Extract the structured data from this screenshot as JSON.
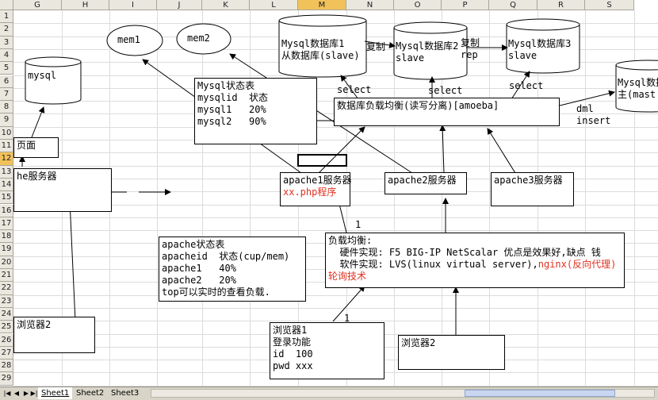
{
  "columns": [
    "G",
    "H",
    "I",
    "J",
    "K",
    "L",
    "M",
    "N",
    "O",
    "P",
    "Q",
    "R",
    "S"
  ],
  "selected_column": "M",
  "rows": [
    "1",
    "2",
    "3",
    "4",
    "5",
    "6",
    "7",
    "8",
    "9",
    "10",
    "11",
    "12",
    "13",
    "14",
    "15",
    "16",
    "17",
    "18",
    "19",
    "20",
    "21",
    "22",
    "23",
    "24",
    "25",
    "26",
    "27",
    "28",
    "29"
  ],
  "selected_row": "12",
  "shapes": {
    "mysql": "mysql",
    "mem1": "mem1",
    "mem2": "mem2",
    "db1": "Mysql数据库1\n从数据库(slave)",
    "copy1": "复制",
    "db2": "Mysql数据库2\nslave",
    "copy2": "复制\nrep",
    "db3": "Mysql数据库3\nslave",
    "master": "Mysql数据\n主(mast",
    "select1": "select",
    "select2": "select",
    "select3": "select",
    "dml": "dml\ninsert",
    "mysql_status": "Mysql状态表\nmysqlid  状态\nmysql1   20%\nmysql2   90%",
    "db_lb": "数据库负载均衡(读写分离)[amoeba]",
    "page_box": "页面",
    "server_box": "he服务器",
    "apache1": "apache1服务器",
    "apache1_red": "xx.php程序",
    "apache2": "apache2服务器",
    "apache3": "apache3服务器",
    "apache_status": "apache状态表\napacheid  状态(cup/mem)\napache1   40%\napache2   20%\ntop可以实时的查看负载.",
    "lb_title": "负载均衡:",
    "lb_hw": "  硬件实现: F5 BIG-IP NetScalar 优点是效果好,缺点 钱",
    "lb_sw_a": "  软件实现: LVS(linux virtual server),",
    "lb_sw_b": "nginx(反向代理)",
    "lb_round": "轮询技术",
    "num1a": "1",
    "num1b": "1",
    "browser_left": "浏览器2",
    "browser1": "浏览器1\n登录功能\nid  100\npwd xxx",
    "browser2": "浏览器2"
  },
  "sheet_tabs": [
    "Sheet1",
    "Sheet2",
    "Sheet3"
  ],
  "active_tab": "Sheet1",
  "colors": {
    "header_bg": "#e9e7de",
    "selected_header": "#f2c25a",
    "red_text": "#e0301e"
  }
}
